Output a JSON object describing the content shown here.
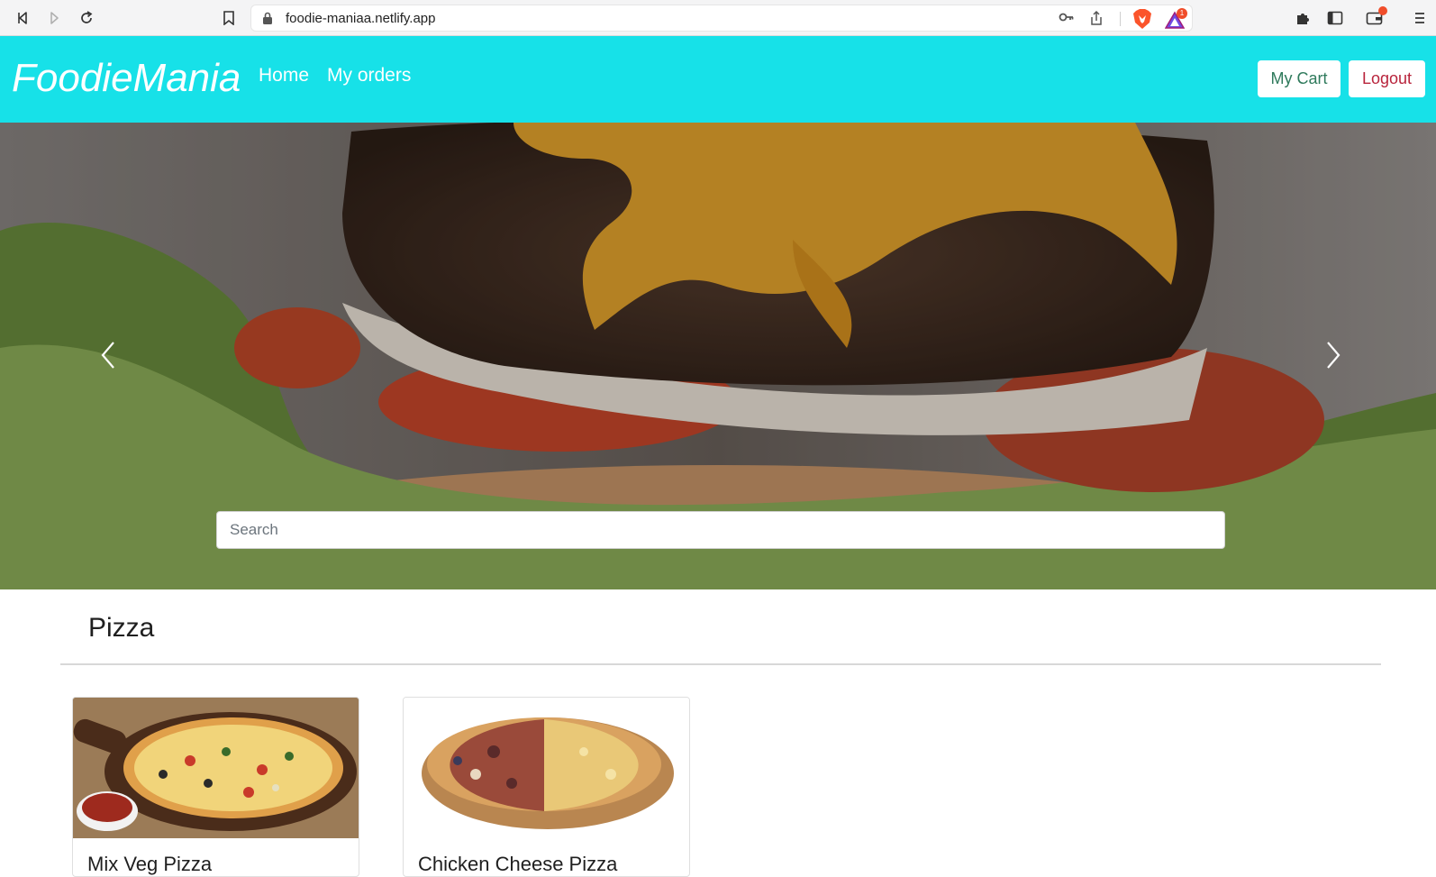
{
  "browser": {
    "url": "foodie-maniaa.netlify.app",
    "rewards_badge": "1",
    "icons": [
      "back-icon",
      "forward-icon",
      "reload-icon",
      "bookmark-icon",
      "lock-icon",
      "key-icon",
      "share-icon",
      "brave-shield-icon",
      "brave-rewards-icon",
      "extensions-icon",
      "sidebar-icon",
      "wallet-icon",
      "menu-icon"
    ]
  },
  "navbar": {
    "brand": "FoodieMania",
    "links": [
      "Home",
      "My orders"
    ],
    "cart_label": "My Cart",
    "logout_label": "Logout",
    "bg_color": "#17e1e8"
  },
  "hero": {
    "search_placeholder": "Search"
  },
  "section": {
    "title": "Pizza",
    "items": [
      {
        "name": "Mix Veg Pizza"
      },
      {
        "name": "Chicken Cheese Pizza"
      }
    ]
  }
}
